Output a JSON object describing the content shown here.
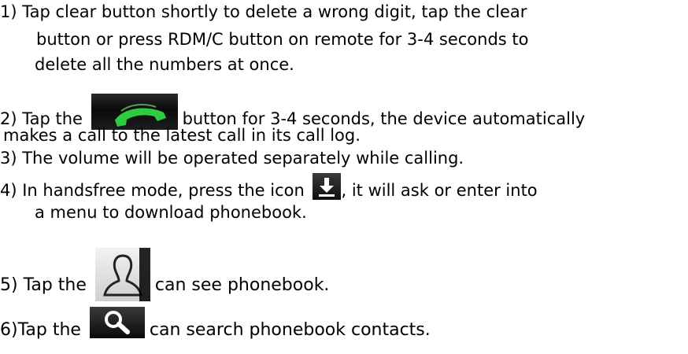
{
  "instructions": {
    "item1": {
      "line1": "1)  Tap clear button shortly to delete a wrong digit, tap the clear",
      "line2": "button or press RDM/C button on remote for 3-4 seconds to",
      "line3": "delete all the numbers at once."
    },
    "item2": {
      "before_icon": "2) Tap the ",
      "after_icon": "button for 3-4 seconds, the device automatically",
      "line2": "makes a call to the latest call in its call log."
    },
    "item3": {
      "line1": "3)  The volume will be operated separately while calling."
    },
    "item4": {
      "before_icon": "4)  In handsfree mode, press the icon ",
      "after_icon": ", it will ask or enter into",
      "line2": "a menu to download phonebook."
    },
    "item5": {
      "before_icon": "5) Tap the ",
      "after_icon": "can see phonebook."
    },
    "item6": {
      "before_icon": "6)Tap the ",
      "after_icon": "can search phonebook contacts."
    }
  },
  "icons": {
    "call": "phone-call-icon",
    "download": "download-icon",
    "contacts": "contact-icon",
    "search": "search-icon"
  },
  "colors": {
    "call_green": "#2ecc40",
    "icon_dark": "#111111"
  }
}
